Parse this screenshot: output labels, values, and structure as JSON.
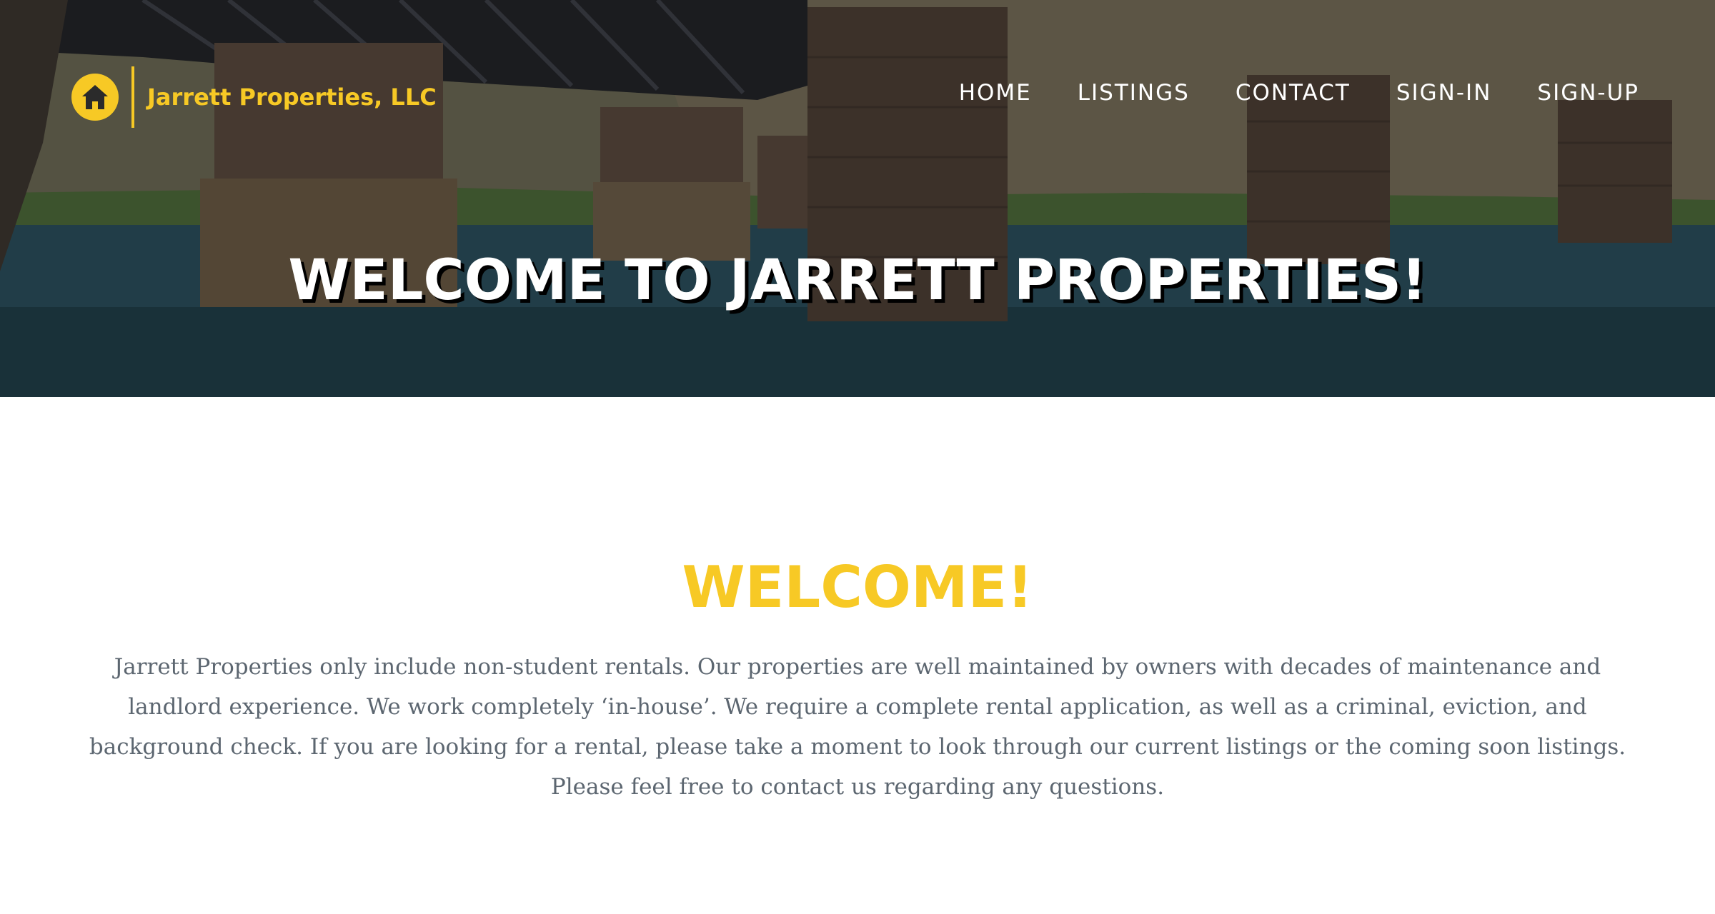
{
  "brand": {
    "name": "Jarrett Properties, LLC",
    "icon": "house-icon",
    "color": "#f7c925"
  },
  "nav": {
    "items": [
      {
        "label": "HOME"
      },
      {
        "label": "LISTINGS"
      },
      {
        "label": "CONTACT"
      },
      {
        "label": "SIGN-IN"
      },
      {
        "label": "SIGN-UP"
      }
    ]
  },
  "hero": {
    "title": "WELCOME TO JARRETT PROPERTIES!",
    "background": "railroad bridge over river photo"
  },
  "welcome": {
    "heading": "WELCOME!",
    "body": "Jarrett Properties only include non-student rentals. Our properties are well maintained by owners with decades of maintenance and landlord experience. We work completely ‘in-house’. We require a complete rental application, as well as a criminal, eviction, and background check. If you are looking for a rental, please take a moment to look through our current listings or the coming soon listings. Please feel free to contact us regarding any questions."
  }
}
